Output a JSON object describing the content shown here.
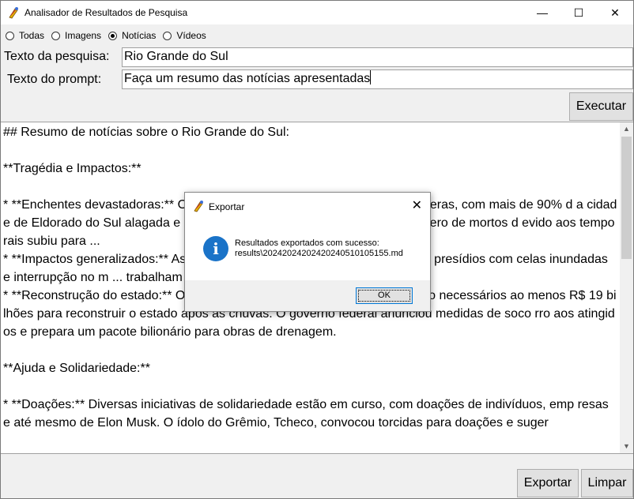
{
  "window": {
    "title": "Analisador de Resultados de Pesquisa",
    "minimize": "—",
    "maximize": "☐",
    "close": "✕"
  },
  "search_type": {
    "options": [
      "Todas",
      "Imagens",
      "Notícias",
      "Vídeos"
    ],
    "selected": "Notícias"
  },
  "form": {
    "search_label": "Texto da pesquisa:",
    "search_value": "Rio Grande do Sul",
    "prompt_label": "Texto do prompt:",
    "prompt_value": "Faça um resumo das notícias apresentadas",
    "execute_label": "Executar"
  },
  "results": {
    "text": "## Resumo de notícias sobre o Rio Grande do Sul:\n\n**Tragédia e Impactos:**\n\n* **Enchentes devastadoras:** O Rio Grande do Sul enfrenta enchentes severas, com mais de 90% d a cidade de Eldorado do Sul alagada e moradores ilhados \"entre os carros\". O número de mortos d evido aos temporais subiu para ...\n* **Impactos generalizados:** As chuvas atingem diversos setores, incluindo presídios com celas inundadas e interrupção no m ... trabalham no resgate de quase 10 mil anim ais.\n* **Reconstrução do estado:** O governador Eduardo Leite estima que serão necessários ao menos R$ 19 bilhões para reconstruir o estado após as chuvas. O governo federal anunciou medidas de soco rro aos atingidos e prepara um pacote bilionário para obras de drenagem.\n\n**Ajuda e Solidariedade:**\n\n* **Doações:** Diversas iniciativas de solidariedade estão em curso, com doações de indivíduos, emp resas e até mesmo de Elon Musk. O ídolo do Grêmio, Tcheco, convocou torcidas para doações e suger"
  },
  "bottom": {
    "export_label": "Exportar",
    "clear_label": "Limpar"
  },
  "dialog": {
    "title": "Exportar",
    "close": "✕",
    "icon": "i",
    "message_line1": "Resultados exportados com sucesso:",
    "message_line2": "results\\20242024202420240510105155.md",
    "ok_label": "OK"
  },
  "colors": {
    "info_icon": "#1a73c8",
    "ok_border": "#0078d7"
  }
}
